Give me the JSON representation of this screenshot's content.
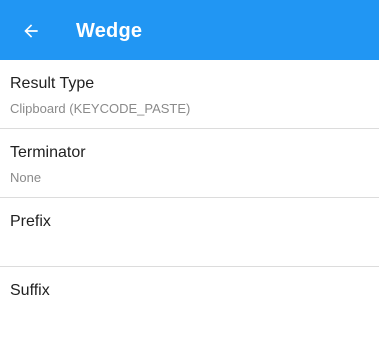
{
  "toolbar": {
    "title": "Wedge",
    "back_icon": "arrow-left-icon",
    "background": "#2196f3"
  },
  "preferences": [
    {
      "title": "Result Type",
      "summary": "Clipboard (KEYCODE_PASTE)"
    },
    {
      "title": "Terminator",
      "summary": "None"
    },
    {
      "title": "Prefix",
      "summary": ""
    },
    {
      "title": "Suffix",
      "summary": ""
    }
  ]
}
